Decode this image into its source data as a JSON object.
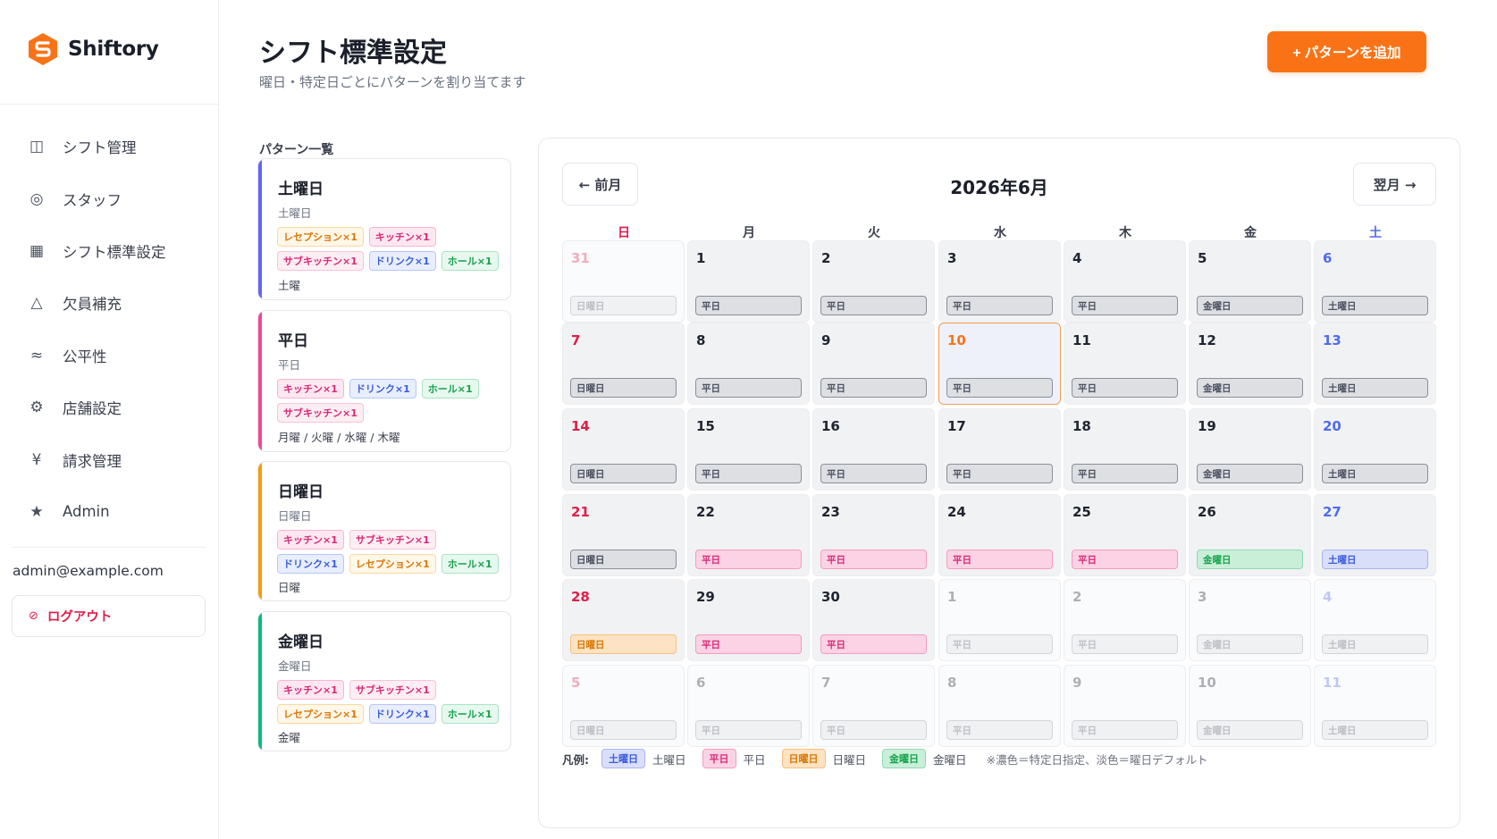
{
  "app": {
    "name": "Shiftory"
  },
  "sidebar": {
    "items": [
      {
        "label": "シフト管理",
        "icon": "◫",
        "icon_name": "calendar-panel-icon"
      },
      {
        "label": "スタッフ",
        "icon": "◎",
        "icon_name": "staff-icon"
      },
      {
        "label": "シフト標準設定",
        "icon": "▦",
        "icon_name": "grid-icon"
      },
      {
        "label": "欠員補充",
        "icon": "△",
        "icon_name": "warning-icon"
      },
      {
        "label": "公平性",
        "icon": "≈",
        "icon_name": "balance-icon"
      },
      {
        "label": "店舗設定",
        "icon": "⚙",
        "icon_name": "gear-icon"
      },
      {
        "label": "請求管理",
        "icon": "¥",
        "icon_name": "yen-icon"
      },
      {
        "label": "Admin",
        "icon": "★",
        "icon_name": "star-icon"
      }
    ],
    "email": "admin@example.com",
    "logout": {
      "label": "ログアウト",
      "icon": "⊘"
    }
  },
  "header": {
    "title": "シフト標準設定",
    "subtitle": "曜日・特定日ごとにパターンを割り当てます",
    "add_button": "+ パターンを追加"
  },
  "patterns": {
    "title": "パターン一覧",
    "items": [
      {
        "name": "土曜日",
        "sub": "土曜日",
        "accent": "#6366f1",
        "tags": [
          {
            "label": "レセプション×1",
            "kind": "reception"
          },
          {
            "label": "キッチン×1",
            "kind": "kitchen"
          },
          {
            "label": "サブキッチン×1",
            "kind": "subkitchen"
          },
          {
            "label": "ドリンク×1",
            "kind": "drink"
          },
          {
            "label": "ホール×1",
            "kind": "hall"
          }
        ],
        "days": "土曜"
      },
      {
        "name": "平日",
        "sub": "平日",
        "accent": "#ec4899",
        "tags": [
          {
            "label": "キッチン×1",
            "kind": "kitchen"
          },
          {
            "label": "ドリンク×1",
            "kind": "drink"
          },
          {
            "label": "ホール×1",
            "kind": "hall"
          },
          {
            "label": "サブキッチン×1",
            "kind": "subkitchen"
          }
        ],
        "days": "月曜 / 火曜 / 水曜 / 木曜"
      },
      {
        "name": "日曜日",
        "sub": "日曜日",
        "accent": "#f59e0b",
        "tags": [
          {
            "label": "キッチン×1",
            "kind": "kitchen"
          },
          {
            "label": "サブキッチン×1",
            "kind": "subkitchen"
          },
          {
            "label": "ドリンク×1",
            "kind": "drink"
          },
          {
            "label": "レセプション×1",
            "kind": "reception"
          },
          {
            "label": "ホール×1",
            "kind": "hall"
          }
        ],
        "days": "日曜"
      },
      {
        "name": "金曜日",
        "sub": "金曜日",
        "accent": "#10b981",
        "tags": [
          {
            "label": "キッチン×1",
            "kind": "kitchen"
          },
          {
            "label": "サブキッチン×1",
            "kind": "subkitchen"
          },
          {
            "label": "レセプション×1",
            "kind": "reception"
          },
          {
            "label": "ドリンク×1",
            "kind": "drink"
          },
          {
            "label": "ホール×1",
            "kind": "hall"
          }
        ],
        "days": "金曜"
      }
    ]
  },
  "tag_colors": {
    "reception": {
      "bg": "#fff7e8",
      "border": "#fcd9a0",
      "fg": "#d97706"
    },
    "kitchen": {
      "bg": "#fde8f1",
      "border": "#f9b4d0",
      "fg": "#db2777"
    },
    "subkitchen": {
      "bg": "#fdeef3",
      "border": "#f7c3d6",
      "fg": "#db2777"
    },
    "drink": {
      "bg": "#e8eefe",
      "border": "#b7c6f8",
      "fg": "#3b5bdb"
    },
    "hall": {
      "bg": "#e7f8ef",
      "border": "#a9e4c5",
      "fg": "#16a34a"
    }
  },
  "calendar": {
    "prev": "← 前月",
    "next": "翌月 →",
    "title": "2026年6月",
    "dow": [
      "日",
      "月",
      "火",
      "水",
      "木",
      "金",
      "土"
    ],
    "weeks": [
      [
        {
          "d": "31",
          "p": "日曜日",
          "s": "default",
          "o": 1
        },
        {
          "d": "1",
          "p": "平日",
          "s": "default"
        },
        {
          "d": "2",
          "p": "平日",
          "s": "default"
        },
        {
          "d": "3",
          "p": "平日",
          "s": "default"
        },
        {
          "d": "4",
          "p": "平日",
          "s": "default"
        },
        {
          "d": "5",
          "p": "金曜日",
          "s": "default"
        },
        {
          "d": "6",
          "p": "土曜日",
          "s": "default"
        }
      ],
      [
        {
          "d": "7",
          "p": "日曜日",
          "s": "default"
        },
        {
          "d": "8",
          "p": "平日",
          "s": "default"
        },
        {
          "d": "9",
          "p": "平日",
          "s": "default"
        },
        {
          "d": "10",
          "p": "平日",
          "s": "default",
          "today": 1
        },
        {
          "d": "11",
          "p": "平日",
          "s": "default"
        },
        {
          "d": "12",
          "p": "金曜日",
          "s": "default"
        },
        {
          "d": "13",
          "p": "土曜日",
          "s": "default"
        }
      ],
      [
        {
          "d": "14",
          "p": "日曜日",
          "s": "default"
        },
        {
          "d": "15",
          "p": "平日",
          "s": "default"
        },
        {
          "d": "16",
          "p": "平日",
          "s": "default"
        },
        {
          "d": "17",
          "p": "平日",
          "s": "default"
        },
        {
          "d": "18",
          "p": "平日",
          "s": "default"
        },
        {
          "d": "19",
          "p": "金曜日",
          "s": "default"
        },
        {
          "d": "20",
          "p": "土曜日",
          "s": "default"
        }
      ],
      [
        {
          "d": "21",
          "p": "日曜日",
          "s": "default"
        },
        {
          "d": "22",
          "p": "平日",
          "s": "weekday"
        },
        {
          "d": "23",
          "p": "平日",
          "s": "weekday"
        },
        {
          "d": "24",
          "p": "平日",
          "s": "weekday"
        },
        {
          "d": "25",
          "p": "平日",
          "s": "weekday"
        },
        {
          "d": "26",
          "p": "金曜日",
          "s": "friday"
        },
        {
          "d": "27",
          "p": "土曜日",
          "s": "saturday"
        }
      ],
      [
        {
          "d": "28",
          "p": "日曜日",
          "s": "sunday"
        },
        {
          "d": "29",
          "p": "平日",
          "s": "weekday"
        },
        {
          "d": "30",
          "p": "平日",
          "s": "weekday"
        },
        {
          "d": "1",
          "p": "平日",
          "s": "default",
          "o": 1
        },
        {
          "d": "2",
          "p": "平日",
          "s": "default",
          "o": 1
        },
        {
          "d": "3",
          "p": "金曜日",
          "s": "default",
          "o": 1
        },
        {
          "d": "4",
          "p": "土曜日",
          "s": "default",
          "o": 1
        }
      ],
      [
        {
          "d": "5",
          "p": "日曜日",
          "s": "default",
          "o": 1
        },
        {
          "d": "6",
          "p": "平日",
          "s": "default",
          "o": 1
        },
        {
          "d": "7",
          "p": "平日",
          "s": "default",
          "o": 1
        },
        {
          "d": "8",
          "p": "平日",
          "s": "default",
          "o": 1
        },
        {
          "d": "9",
          "p": "平日",
          "s": "default",
          "o": 1
        },
        {
          "d": "10",
          "p": "金曜日",
          "s": "default",
          "o": 1
        },
        {
          "d": "11",
          "p": "土曜日",
          "s": "default",
          "o": 1
        }
      ]
    ],
    "legend": {
      "title": "凡例:",
      "items": [
        {
          "badge": "土曜日",
          "text": "土曜日",
          "s": "saturday"
        },
        {
          "badge": "平日",
          "text": "平日",
          "s": "weekday"
        },
        {
          "badge": "日曜日",
          "text": "日曜日",
          "s": "sunday"
        },
        {
          "badge": "金曜日",
          "text": "金曜日",
          "s": "friday"
        }
      ],
      "note": "※濃色＝特定日指定、淡色＝曜日デフォルト"
    }
  },
  "colors": {
    "accent": "#f97316",
    "sunday": "#e11d48",
    "saturday": "#4f6bed",
    "badge_styles": {
      "default": {
        "bg": "#dedfe3",
        "border": "#8a8f99",
        "fg": "#4b5160"
      },
      "weekday": {
        "bg": "#fbd3e4",
        "border": "#f39cc0",
        "fg": "#db2777"
      },
      "sunday": {
        "bg": "#fde3c3",
        "border": "#f8c07e",
        "fg": "#d97706"
      },
      "friday": {
        "bg": "#c9efd9",
        "border": "#8fd9b1",
        "fg": "#16a34a"
      },
      "saturday": {
        "bg": "#d9def9",
        "border": "#aab5f2",
        "fg": "#3b5bdb"
      }
    }
  }
}
